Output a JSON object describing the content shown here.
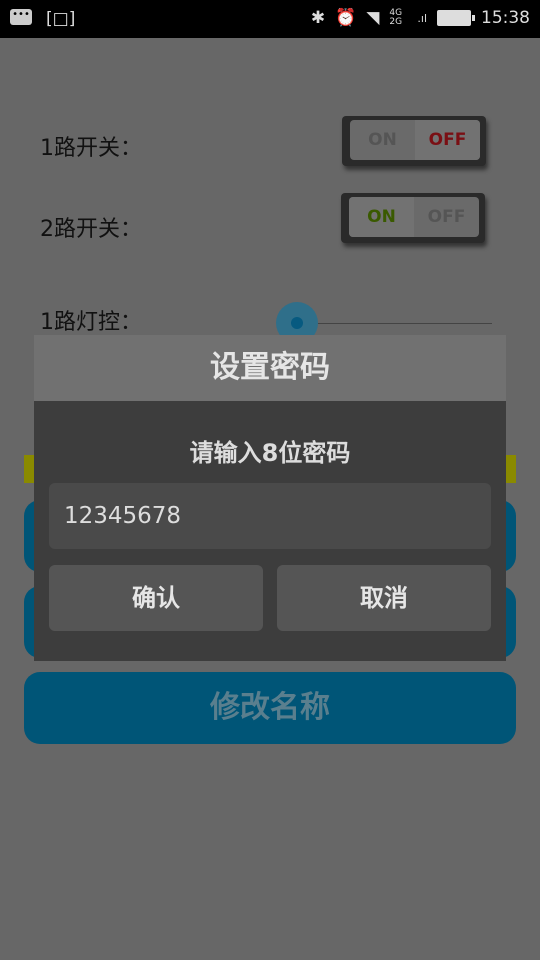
{
  "status_bar": {
    "time": "15:38",
    "network": "4G 2G"
  },
  "rows": [
    {
      "label": "1路开关："
    },
    {
      "label": "2路开关："
    },
    {
      "label": "1路灯控："
    }
  ],
  "toggle1": {
    "on": "ON",
    "off": "OFF",
    "state": "off"
  },
  "toggle2": {
    "on": "ON",
    "off": "OFF",
    "state": "on"
  },
  "slider": {
    "value": 0
  },
  "buttons": {
    "rename": "修改名称"
  },
  "dialog": {
    "title": "设置密码",
    "message": "请输入8位密码",
    "input_value": "12345678",
    "confirm": "确认",
    "cancel": "取消"
  },
  "colors": {
    "on_green": "#3a5a00",
    "off_red": "#7a0f14",
    "accent_blue": "#005577"
  }
}
